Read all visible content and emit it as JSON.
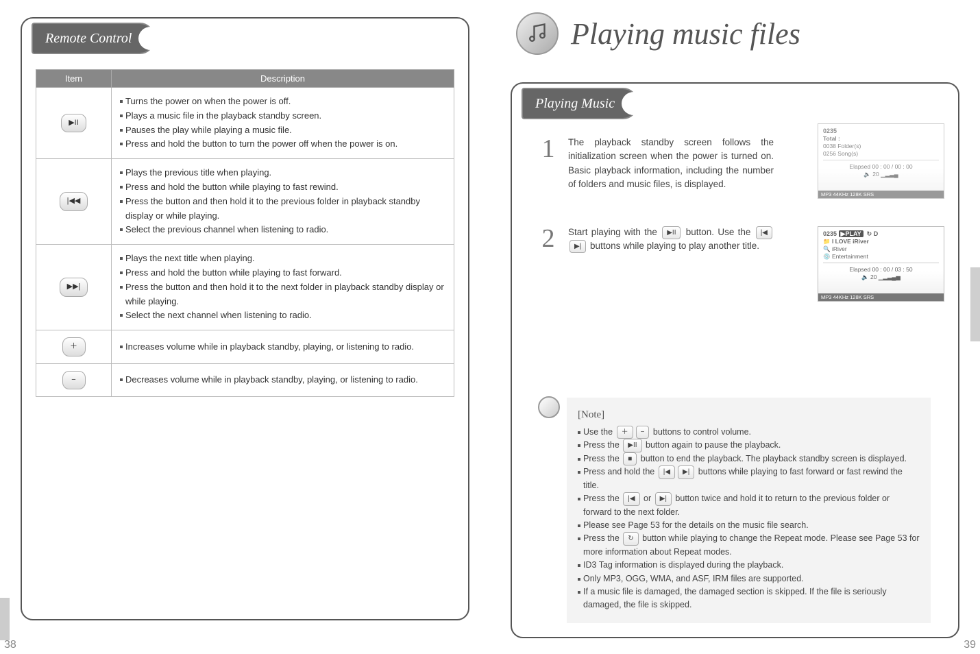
{
  "leftPage": {
    "sectionTitle": "Remote Control",
    "table": {
      "col1": "Item",
      "col2": "Description",
      "rows": [
        {
          "iconAlt": "play-pause-button",
          "iconGlyph": "▶II",
          "desc": [
            "Turns the power on when the power is off.",
            "Plays a music file in the playback standby screen.",
            "Pauses the play while playing a music file.",
            "Press and hold the button to turn the power off when the power is on."
          ]
        },
        {
          "iconAlt": "prev-button",
          "iconGlyph": "|◀◀",
          "desc": [
            "Plays the previous title when playing.",
            "Press and hold the button while playing to fast rewind.",
            "Press the button and then hold it to the previous folder in playback standby display or while playing.",
            "Select the previous channel when listening to radio."
          ]
        },
        {
          "iconAlt": "next-button",
          "iconGlyph": "▶▶|",
          "desc": [
            "Plays the next title when playing.",
            "Press and hold the button while playing to fast forward.",
            "Press the button and then hold it to the next folder in playback standby display or while playing.",
            "Select the next channel when listening to radio."
          ]
        },
        {
          "iconAlt": "vol-up-button",
          "iconGlyph": "＋",
          "desc": [
            "Increases volume while in playback standby, playing, or listening to radio."
          ]
        },
        {
          "iconAlt": "vol-down-button",
          "iconGlyph": "−",
          "desc": [
            "Decreases volume while in playback standby, playing, or listening to radio."
          ]
        }
      ]
    },
    "pageNumber": "38"
  },
  "rightPage": {
    "pageTitle": "Playing music files",
    "sectionTitle": "Playing Music",
    "steps": [
      {
        "num": "1",
        "text": "The playback standby screen follows the initialization screen when the power is turned on. Basic playback information, including the number of folders and music files, is displayed."
      }
    ],
    "step2": {
      "num": "2",
      "pre": "Start playing with the ",
      "mid": " button. Use the ",
      "post": " buttons while playing to play another title."
    },
    "noteTitle": "[Note]",
    "notes": {
      "n1a": "Use the ",
      "n1b": " buttons to control volume.",
      "n2a": "Press the ",
      "n2b": " button again to pause the playback.",
      "n3a": "Press the ",
      "n3b": " button to end the playback. The playback standby screen is displayed.",
      "n4a": "Press and hold the ",
      "n4b": " buttons while playing to fast forward or fast rewind the title.",
      "n5a": "Press the ",
      "n5b": " or ",
      "n5c": " button twice and hold it to return to the previous folder or forward to the next folder.",
      "n6": "Please see Page 53 for the details on the music file search.",
      "n7a": "Press the ",
      "n7b": " button while playing to change the Repeat mode. Please see Page 53 for more information about Repeat modes.",
      "n8": "ID3 Tag information is displayed during the playback.",
      "n9": "Only MP3, OGG, WMA, and ASF, IRM files are supported.",
      "n10": "If a music file is damaged, the damaged section is skipped. If the file is seriously damaged, the file is skipped."
    },
    "screen1": {
      "line1": "0235",
      "total": "Total :",
      "folders": "0038 Folder(s)",
      "songs": "0256 Song(s)",
      "elapsed": "Elapsed 00 : 00 / 00 : 00",
      "vol": "20",
      "bar": "MP3  44KHz  128K  SRS"
    },
    "screen2": {
      "line1": "0235",
      "play": "▶PLAY",
      "title": "I  LOVE  iRiver",
      "artist": "iRiver",
      "album": "Entertainment",
      "elapsed": "Elapsed 00 : 00 / 03 : 50",
      "vol": "20",
      "bar": "MP3  44KHz  128K  SRS"
    },
    "pageNumber": "39"
  },
  "icons": {
    "playpause": "▶II",
    "stop": "■",
    "prev": "|◀",
    "next": "▶|",
    "volup": "＋",
    "voldown": "−",
    "repeat": "↻"
  }
}
